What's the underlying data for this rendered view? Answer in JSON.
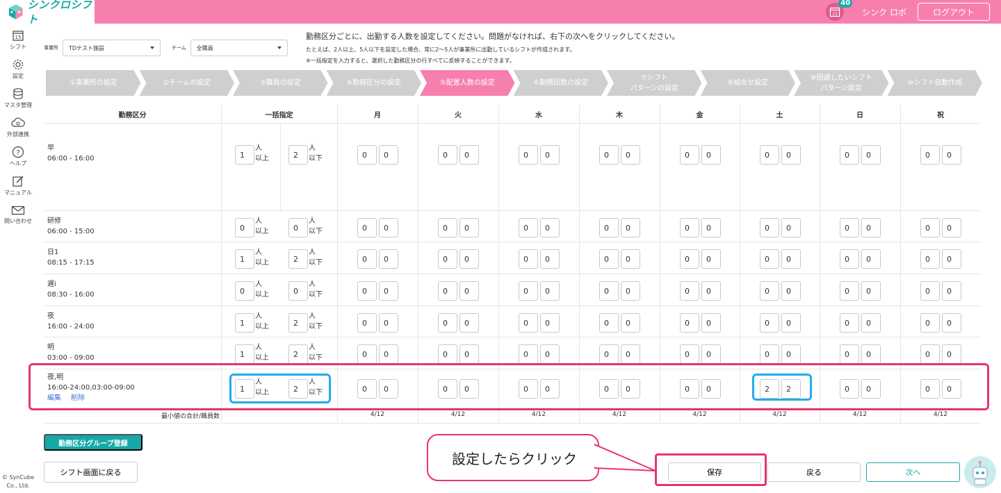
{
  "header": {
    "logo_text": "シンクロシフト",
    "calendar_day": "15",
    "notification_count": "40",
    "user_name": "シンク ロボ",
    "logout_label": "ログアウト"
  },
  "sidebar": {
    "items": [
      {
        "label": "シフト",
        "icon": "calendar-icon"
      },
      {
        "label": "設定",
        "icon": "gear-icon"
      },
      {
        "label": "マスタ管理",
        "icon": "database-icon"
      },
      {
        "label": "外部連携",
        "icon": "cloud-icon"
      },
      {
        "label": "ヘルプ",
        "icon": "help-icon"
      },
      {
        "label": "マニュアル",
        "icon": "edit-icon"
      },
      {
        "label": "問い合わせ",
        "icon": "mail-icon"
      }
    ],
    "calendar_day": "15",
    "copyright_line1": "© SynCube",
    "copyright_line2": "Co., Ltd."
  },
  "filters": {
    "office_label": "事業所",
    "office_value": "TDテスト施設",
    "team_label": "チーム",
    "team_value": "全職員"
  },
  "instructions": {
    "line1": "勤務区分ごとに、出勤する人数を設定してください。問題がなければ、右下の次へをクリックしてください。",
    "line2": "たとえば、2人以上、5人以下を設定した場合、常に2〜5人が事業所に出勤しているシフトが作成されます。",
    "line3": "※一括指定を入力すると、選択した勤務区分の行すべてに反映することができます。"
  },
  "steps": [
    {
      "label": "①事業所の設定"
    },
    {
      "label": "②チームの設定"
    },
    {
      "label": "③職員の設定"
    },
    {
      "label": "④勤務区分の設定"
    },
    {
      "label": "⑤配置人数の設定",
      "active": true
    },
    {
      "label": "⑥勤務回数の設定"
    },
    {
      "label": "⑦シフト\nパターンの設定"
    },
    {
      "label": "⑧組合せ設定"
    },
    {
      "label": "⑨回避したいシフト\nパターン設定"
    },
    {
      "label": "⑩シフト自動作成"
    }
  ],
  "table": {
    "headers": {
      "shift": "勤務区分",
      "bulk": "一括指定",
      "days": [
        "月",
        "火",
        "水",
        "木",
        "金",
        "土",
        "日",
        "祝"
      ]
    },
    "unit_upper_1": "人",
    "unit_upper_2": "以上",
    "unit_lower_1": "人",
    "unit_lower_2": "以下",
    "rows": [
      {
        "name": "早",
        "time": "06:00 - 16:00",
        "bulk_min": "1",
        "bulk_max": "2",
        "days": [
          [
            "0",
            "0"
          ],
          [
            "0",
            "0"
          ],
          [
            "0",
            "0"
          ],
          [
            "0",
            "0"
          ],
          [
            "0",
            "0"
          ],
          [
            "0",
            "0"
          ],
          [
            "0",
            "0"
          ],
          [
            "0",
            "0"
          ]
        ]
      },
      {
        "name": "研修",
        "time": "06:00 - 15:00",
        "bulk_min": "0",
        "bulk_max": "0",
        "days": [
          [
            "0",
            "0"
          ],
          [
            "0",
            "0"
          ],
          [
            "0",
            "0"
          ],
          [
            "0",
            "0"
          ],
          [
            "0",
            "0"
          ],
          [
            "0",
            "0"
          ],
          [
            "0",
            "0"
          ],
          [
            "0",
            "0"
          ]
        ]
      },
      {
        "name": "日1",
        "time": "08:15 - 17:15",
        "bulk_min": "1",
        "bulk_max": "2",
        "days": [
          [
            "0",
            "0"
          ],
          [
            "0",
            "0"
          ],
          [
            "0",
            "0"
          ],
          [
            "0",
            "0"
          ],
          [
            "0",
            "0"
          ],
          [
            "0",
            "0"
          ],
          [
            "0",
            "0"
          ],
          [
            "0",
            "0"
          ]
        ]
      },
      {
        "name": "遅i",
        "time": "08:30 - 16:00",
        "bulk_min": "0",
        "bulk_max": "0",
        "days": [
          [
            "0",
            "0"
          ],
          [
            "0",
            "0"
          ],
          [
            "0",
            "0"
          ],
          [
            "0",
            "0"
          ],
          [
            "0",
            "0"
          ],
          [
            "0",
            "0"
          ],
          [
            "0",
            "0"
          ],
          [
            "0",
            "0"
          ]
        ]
      },
      {
        "name": "夜",
        "time": "16:00 - 24:00",
        "bulk_min": "1",
        "bulk_max": "2",
        "days": [
          [
            "0",
            "0"
          ],
          [
            "0",
            "0"
          ],
          [
            "0",
            "0"
          ],
          [
            "0",
            "0"
          ],
          [
            "0",
            "0"
          ],
          [
            "0",
            "0"
          ],
          [
            "0",
            "0"
          ],
          [
            "0",
            "0"
          ]
        ]
      },
      {
        "name": "明",
        "time": "03:00 - 09:00",
        "bulk_min": "1",
        "bulk_max": "2",
        "days": [
          [
            "0",
            "0"
          ],
          [
            "0",
            "0"
          ],
          [
            "0",
            "0"
          ],
          [
            "0",
            "0"
          ],
          [
            "0",
            "0"
          ],
          [
            "0",
            "0"
          ],
          [
            "0",
            "0"
          ],
          [
            "0",
            "0"
          ]
        ]
      },
      {
        "name": "夜,明",
        "time": "16:00-24:00,03:00-09:00",
        "bulk_min": "1",
        "bulk_max": "2",
        "edit_label": "編集",
        "delete_label": "削除",
        "days": [
          [
            "0",
            "0"
          ],
          [
            "0",
            "0"
          ],
          [
            "0",
            "0"
          ],
          [
            "0",
            "0"
          ],
          [
            "0",
            "0"
          ],
          [
            "2",
            "2"
          ],
          [
            "0",
            "0"
          ],
          [
            "0",
            "0"
          ]
        ]
      }
    ],
    "footer_label": "最小値の合計/職員数",
    "footer_values": [
      "4/12",
      "4/12",
      "4/12",
      "4/12",
      "4/12",
      "4/12",
      "4/12",
      "4/12"
    ]
  },
  "buttons": {
    "group_register": "勤務区分グループ登録",
    "back_to_shift": "シフト画面に戻る",
    "save": "保存",
    "back": "戻る",
    "next": "次へ"
  },
  "callout": {
    "text": "設定したらクリック"
  },
  "colors": {
    "header_pink": "#f77fae",
    "active_step": "#f77fae",
    "teal": "#15a8a8",
    "highlight_red": "#e8336e",
    "highlight_blue": "#22aaee"
  }
}
